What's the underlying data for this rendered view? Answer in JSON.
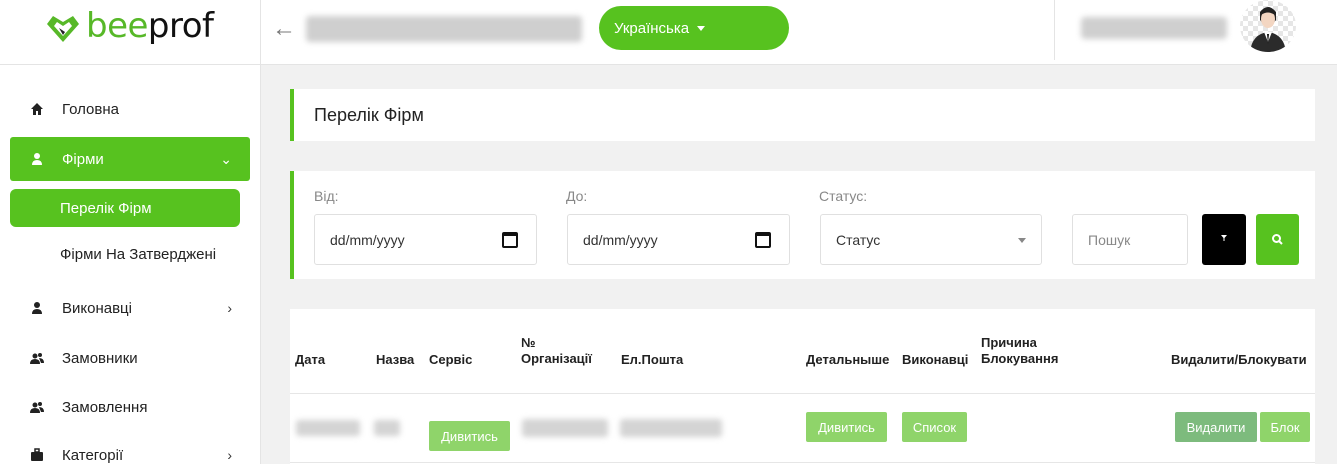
{
  "brand": {
    "name_part1": "bee",
    "name_part2": "prof",
    "accent": "#57c21f"
  },
  "header": {
    "language": "Українська"
  },
  "sidebar": {
    "items": [
      {
        "label": "Головна",
        "icon": "home-icon"
      },
      {
        "label": "Фірми",
        "icon": "user-icon"
      },
      {
        "label": "Виконавці",
        "icon": "user-icon"
      },
      {
        "label": "Замовники",
        "icon": "users-icon"
      },
      {
        "label": "Замовлення",
        "icon": "users-icon"
      },
      {
        "label": "Категорії",
        "icon": "briefcase-icon"
      }
    ],
    "subitems": [
      {
        "label": "Перелік Фірм"
      },
      {
        "label": "Фірми На Затверджені"
      }
    ]
  },
  "page": {
    "title": "Перелік Фірм"
  },
  "filters": {
    "from_label": "Від:",
    "from_value": "dd/mm/yyyy",
    "to_label": "До:",
    "to_value": "dd/mm/yyyy",
    "status_label": "Статус:",
    "status_value": "Статус",
    "search_placeholder": "Пошук"
  },
  "table": {
    "headers": {
      "date": "Дата",
      "name": "Назва",
      "service": "Сервіс",
      "org_no_1": "№",
      "org_no_2": "Організації",
      "email": "Ел.Пошта",
      "details": "Детальныше",
      "performers": "Виконавці",
      "reason_1": "Причина",
      "reason_2": "Блокування",
      "actions": "Видалити/Блокувати"
    },
    "row": {
      "service_btn": "Дивитись",
      "details_btn": "Дивитись",
      "performers_btn": "Список",
      "delete_btn": "Видалити",
      "block_btn": "Блок"
    }
  }
}
